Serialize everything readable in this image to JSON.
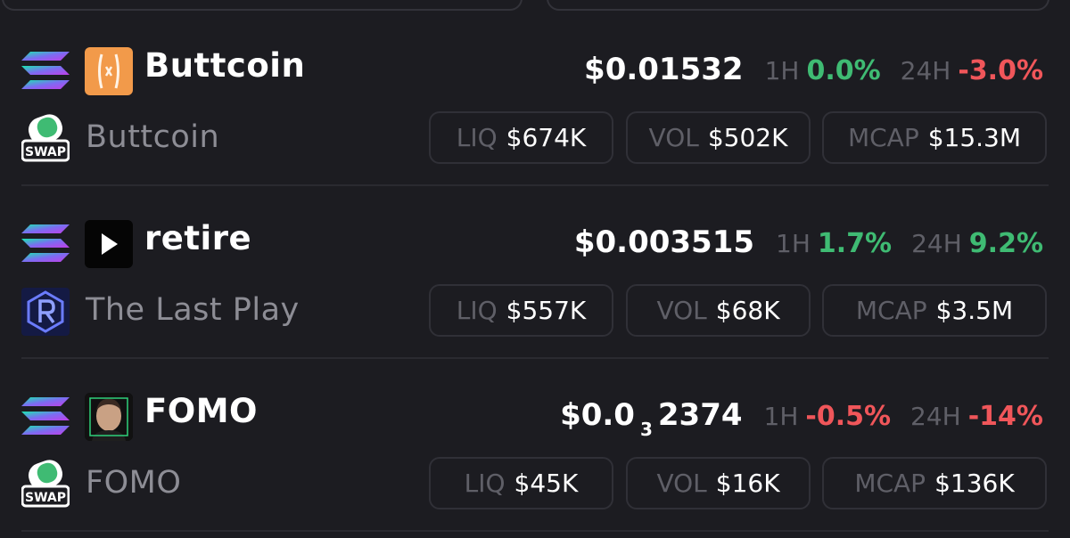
{
  "colors": {
    "background": "#1c1c21",
    "positive": "#3fbb73",
    "negative": "#f0565a",
    "muted": "#5f5f67",
    "name_text": "#8d8d95",
    "pill_border": "#303037"
  },
  "labels": {
    "h1": "1H",
    "h24": "24H",
    "liq": "LIQ",
    "vol": "VOL",
    "mcap": "MCAP"
  },
  "tokens": [
    {
      "chain_icon": "solana-icon",
      "token_icon": "buttcoin-logo-icon",
      "dex_icon": "swap-icon",
      "dex_label": "SWAP",
      "symbol": "Buttcoin",
      "name": "Buttcoin",
      "price": "$0.01532",
      "change_1h": "0.0%",
      "change_1h_dir": "pos",
      "change_24h": "-3.0%",
      "change_24h_dir": "neg",
      "liq": "$674K",
      "vol": "$502K",
      "mcap": "$15.3M"
    },
    {
      "chain_icon": "solana-icon",
      "token_icon": "play-logo-icon",
      "dex_icon": "raydium-icon",
      "symbol": "retire",
      "name": "The Last Play",
      "price": "$0.003515",
      "change_1h": "1.7%",
      "change_1h_dir": "pos",
      "change_24h": "9.2%",
      "change_24h_dir": "pos",
      "liq": "$557K",
      "vol": "$68K",
      "mcap": "$3.5M"
    },
    {
      "chain_icon": "solana-icon",
      "token_icon": "face-avatar-icon",
      "dex_icon": "swap-icon",
      "dex_label": "SWAP",
      "symbol": "FOMO",
      "name": "FOMO",
      "price_prefix": "$0.0",
      "price_sub": "3",
      "price_suffix": "2374",
      "change_1h": "-0.5%",
      "change_1h_dir": "neg",
      "change_24h": "-14%",
      "change_24h_dir": "neg",
      "liq": "$45K",
      "vol": "$16K",
      "mcap": "$136K"
    }
  ]
}
